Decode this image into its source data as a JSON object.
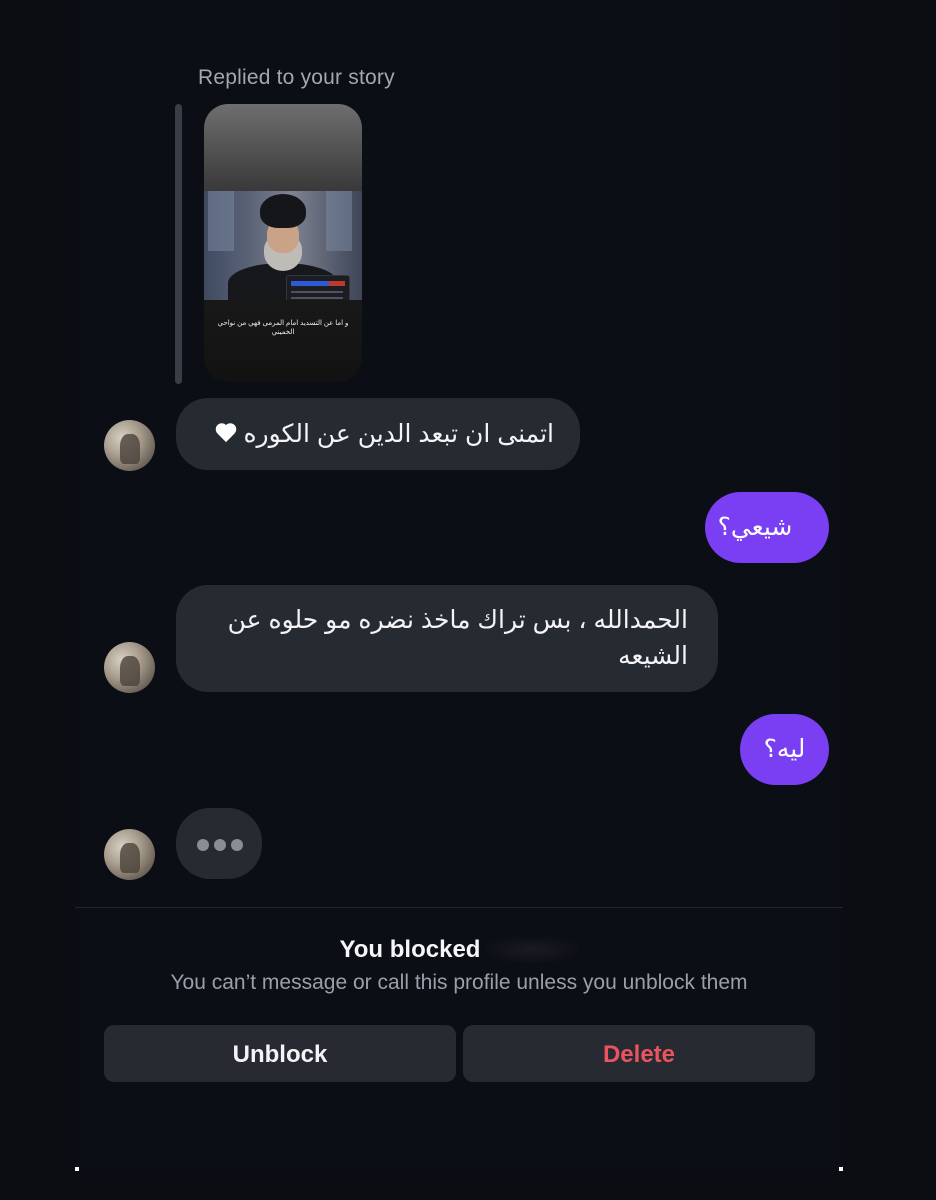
{
  "story_reply": {
    "label": "Replied to your story",
    "story_caption": "و اما عن التسديد امام المرمى فهي من نواحي الخميني"
  },
  "messages": [
    {
      "direction": "incoming",
      "text": "اتمنى ان تبعد الدين عن الكوره",
      "has_heart": true
    },
    {
      "direction": "outgoing",
      "text": "شيعي؟"
    },
    {
      "direction": "incoming",
      "text": "الحمدالله ، بس تراك ماخذ نضره مو حلوه عن الشيعه"
    },
    {
      "direction": "outgoing",
      "text": "ليه؟"
    }
  ],
  "typing_indicator": {
    "visible": true
  },
  "blocked_notice": {
    "title": "You blocked",
    "subtitle": "You can’t message or call this profile unless you unblock them"
  },
  "actions": {
    "unblock_label": "Unblock",
    "delete_label": "Delete"
  },
  "colors": {
    "background": "#0b0d13",
    "incoming_bubble": "#262a31",
    "outgoing_bubble": "#7a3ff2",
    "delete_text": "#e8545f"
  }
}
